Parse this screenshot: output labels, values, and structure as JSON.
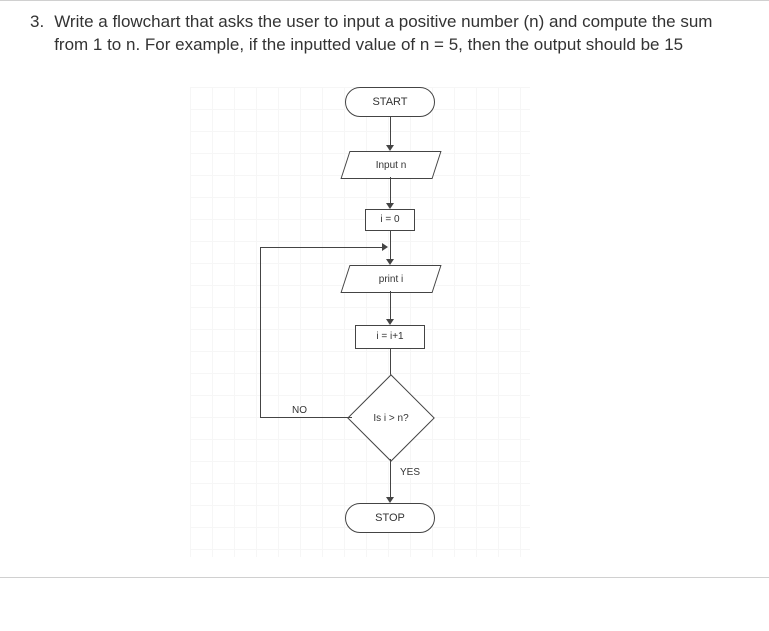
{
  "question": {
    "number": "3.",
    "text": "Write a flowchart that asks the user to input a positive number (n) and compute the sum from 1 to n. For example, if the inputted value of n = 5, then the output should be 15"
  },
  "flowchart": {
    "start": "START",
    "input": "Input n",
    "init": "i = 0",
    "print": "print i",
    "increment": "i = i+1",
    "decision": "Is i > n?",
    "no": "NO",
    "yes": "YES",
    "stop": "STOP"
  },
  "chart_data": {
    "type": "flowchart",
    "nodes": [
      {
        "id": "start",
        "shape": "terminator",
        "label": "START"
      },
      {
        "id": "input",
        "shape": "io",
        "label": "Input n"
      },
      {
        "id": "init",
        "shape": "process",
        "label": "i = 0"
      },
      {
        "id": "print",
        "shape": "io",
        "label": "print i"
      },
      {
        "id": "increment",
        "shape": "process",
        "label": "i = i+1"
      },
      {
        "id": "decision",
        "shape": "decision",
        "label": "Is i > n?"
      },
      {
        "id": "stop",
        "shape": "terminator",
        "label": "STOP"
      }
    ],
    "edges": [
      {
        "from": "start",
        "to": "input"
      },
      {
        "from": "input",
        "to": "init"
      },
      {
        "from": "init",
        "to": "print"
      },
      {
        "from": "print",
        "to": "increment"
      },
      {
        "from": "increment",
        "to": "decision"
      },
      {
        "from": "decision",
        "to": "stop",
        "label": "YES"
      },
      {
        "from": "decision",
        "to": "print",
        "label": "NO"
      }
    ]
  }
}
